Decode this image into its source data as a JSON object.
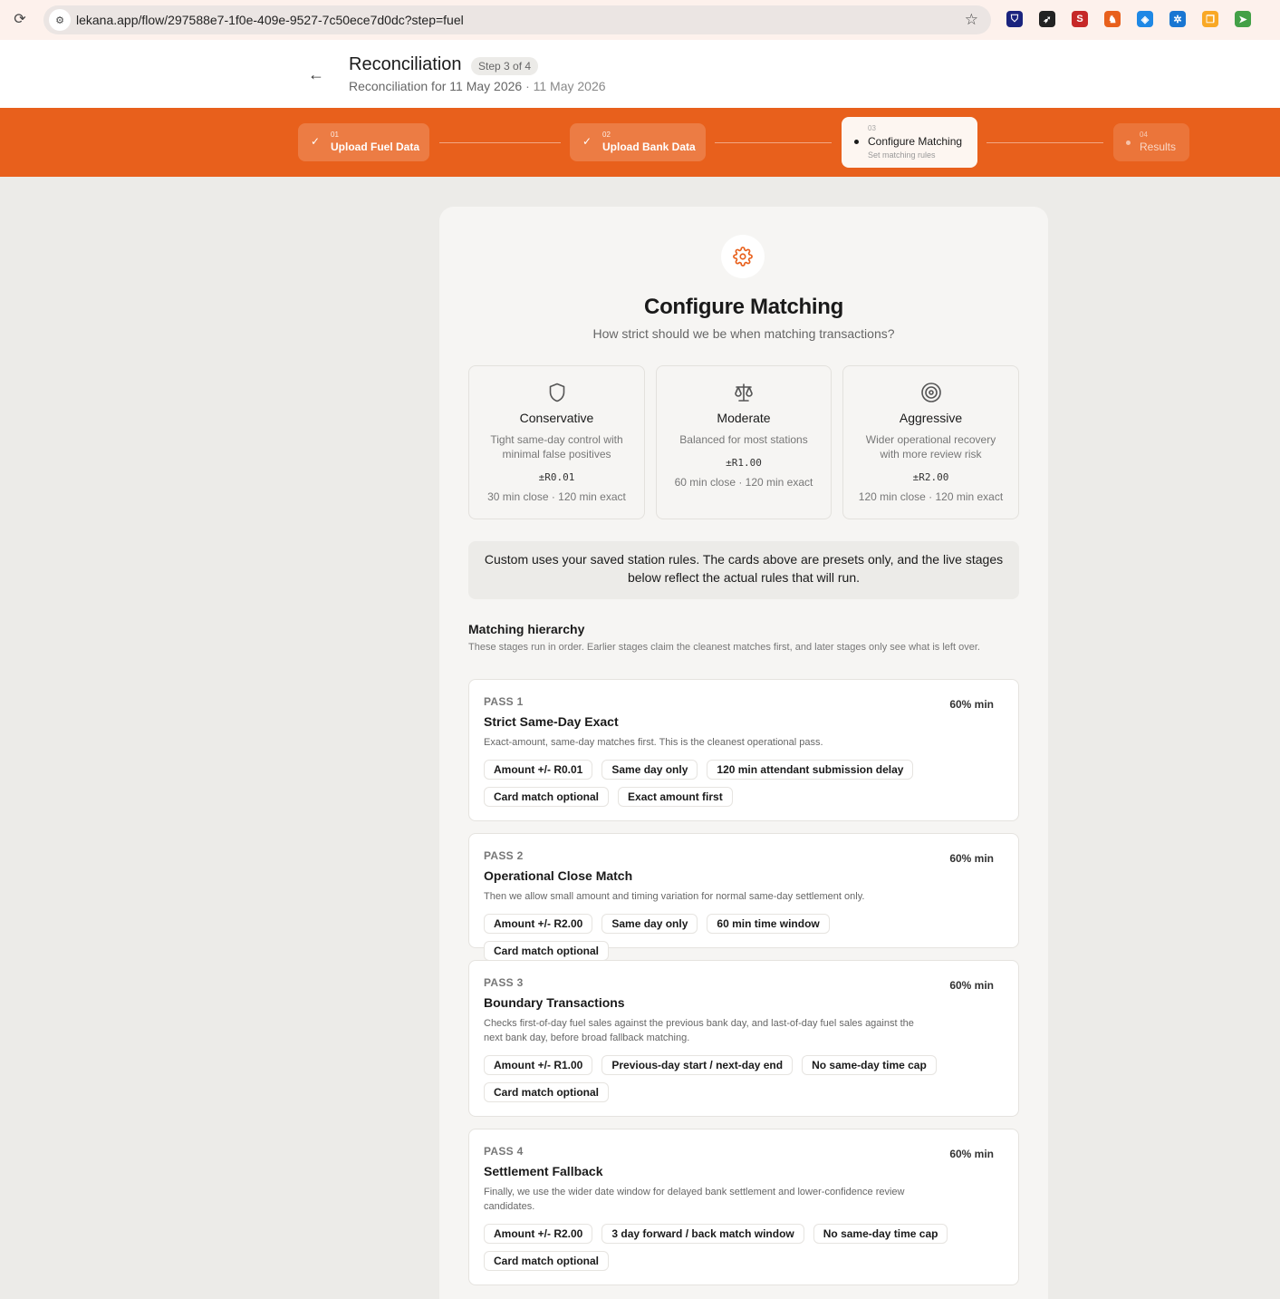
{
  "browser": {
    "url": "lekana.app/flow/297588e7-1f0e-409e-9527-7c50ece7d0dc?step=fuel",
    "extensions": [
      {
        "name": "shield-ext-icon",
        "glyph": "⛉",
        "color": "#1a237e"
      },
      {
        "name": "send-ext-icon",
        "glyph": "➶",
        "color": "#222222"
      },
      {
        "name": "s-ext-icon",
        "glyph": "S",
        "color": "#c62828"
      },
      {
        "name": "chess-ext-icon",
        "glyph": "♞",
        "color": "#e8601c"
      },
      {
        "name": "tag-ext-icon",
        "glyph": "◈",
        "color": "#1e88e5"
      },
      {
        "name": "gear-ext-icon",
        "glyph": "✲",
        "color": "#1976d2"
      },
      {
        "name": "copy-ext-icon",
        "glyph": "❐",
        "color": "#f9a825"
      },
      {
        "name": "cursor-ext-icon",
        "glyph": "➤",
        "color": "#43a047"
      }
    ]
  },
  "header": {
    "title": "Reconciliation",
    "step_badge": "Step 3 of 4",
    "subtitle": "Reconciliation for 11 May 2026",
    "subtitle_date": "· 11 May 2026"
  },
  "stepper": {
    "steps": [
      {
        "num": "01",
        "label": "Upload Fuel Data",
        "state": "done"
      },
      {
        "num": "02",
        "label": "Upload Bank Data",
        "state": "done"
      },
      {
        "num": "03",
        "label": "Configure Matching",
        "sub": "Set matching rules",
        "state": "active"
      },
      {
        "num": "04",
        "label": "Results",
        "state": "pending"
      }
    ]
  },
  "main": {
    "title": "Configure Matching",
    "subtitle": "How strict should we be when matching transactions?",
    "presets": [
      {
        "name": "Conservative",
        "desc": "Tight same-day control with minimal false positives",
        "amount": "±R0.01",
        "timing": "30 min close · 120 min exact",
        "icon": "shield-icon"
      },
      {
        "name": "Moderate",
        "desc": "Balanced for most stations",
        "amount": "±R1.00",
        "timing": "60 min close · 120 min exact",
        "icon": "scale-icon"
      },
      {
        "name": "Aggressive",
        "desc": "Wider operational recovery with more review risk",
        "amount": "±R2.00",
        "timing": "120 min close · 120 min exact",
        "icon": "target-icon"
      }
    ],
    "note": "Custom uses your saved station rules. The cards above are presets only, and the live stages below reflect the actual rules that will run.",
    "hierarchy_title": "Matching hierarchy",
    "hierarchy_desc": "These stages run in order. Earlier stages claim the cleanest matches first, and later stages only see what is left over.",
    "passes": [
      {
        "num": "PASS 1",
        "name": "Strict Same-Day Exact",
        "min": "60% min",
        "desc": "Exact-amount, same-day matches first. This is the cleanest operational pass.",
        "tags": [
          "Amount +/- R0.01",
          "Same day only",
          "120 min attendant submission delay",
          "Card match optional",
          "Exact amount first"
        ]
      },
      {
        "num": "PASS 2",
        "name": "Operational Close Match",
        "min": "60% min",
        "desc": "Then we allow small amount and timing variation for normal same-day settlement only.",
        "tags": [
          "Amount +/- R2.00",
          "Same day only",
          "60 min time window",
          "Card match optional"
        ]
      },
      {
        "num": "PASS 3",
        "name": "Boundary Transactions",
        "min": "60% min",
        "desc": "Checks first-of-day fuel sales against the previous bank day, and last-of-day fuel sales against the next bank day, before broad fallback matching.",
        "tags": [
          "Amount +/- R1.00",
          "Previous-day start / next-day end",
          "No same-day time cap",
          "Card match optional"
        ]
      },
      {
        "num": "PASS 4",
        "name": "Settlement Fallback",
        "min": "60% min",
        "desc": "Finally, we use the wider date window for delayed bank settlement and lower-confidence review candidates.",
        "tags": [
          "Amount +/- R2.00",
          "3 day forward / back match window",
          "No same-day time cap",
          "Card match optional"
        ]
      }
    ]
  },
  "colors": {
    "accent": "#e8601c",
    "page_bg": "#ecebe8",
    "card_bg": "#f6f5f3"
  }
}
